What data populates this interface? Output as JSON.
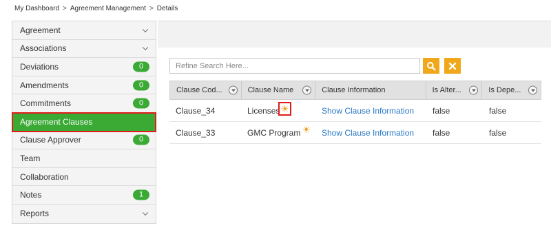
{
  "breadcrumb": {
    "items": [
      "My Dashboard",
      "Agreement Management",
      "Details"
    ],
    "separator": ">"
  },
  "sidebar": {
    "items": [
      {
        "label": "Agreement",
        "type": "expand"
      },
      {
        "label": "Associations",
        "type": "expand"
      },
      {
        "label": "Deviations",
        "badge": "0"
      },
      {
        "label": "Amendments",
        "badge": "0"
      },
      {
        "label": "Commitments",
        "badge": "0"
      },
      {
        "label": "Agreement Clauses",
        "active": true
      },
      {
        "label": "Clause Approver",
        "badge": "0"
      },
      {
        "label": "Team"
      },
      {
        "label": "Collaboration"
      },
      {
        "label": "Notes",
        "badge": "1"
      },
      {
        "label": "Reports",
        "type": "expand"
      }
    ]
  },
  "search": {
    "placeholder": "Refine Search Here...",
    "value": ""
  },
  "icons": {
    "search_button": "search-icon",
    "clear_button": "close-icon",
    "filter": "filter-icon",
    "sun": "sun-icon",
    "chevron": "chevron-down-icon"
  },
  "colors": {
    "accent_orange": "#f0a81a",
    "active_green": "#3aaa35",
    "highlight_red": "#e21b1b",
    "link_blue": "#2a78c6"
  },
  "table": {
    "columns": [
      "Clause Cod...",
      "Clause Name",
      "Clause Information",
      "Is Alter...",
      "Is Depe..."
    ],
    "rows": [
      {
        "code": "Clause_34",
        "name": "Licenses",
        "info": "Show Clause Information",
        "is_alter": "false",
        "is_depe": "false",
        "sun_marked": true
      },
      {
        "code": "Clause_33",
        "name": "GMC Program",
        "info": "Show Clause Information",
        "is_alter": "false",
        "is_depe": "false",
        "sun_marked": false
      }
    ]
  }
}
